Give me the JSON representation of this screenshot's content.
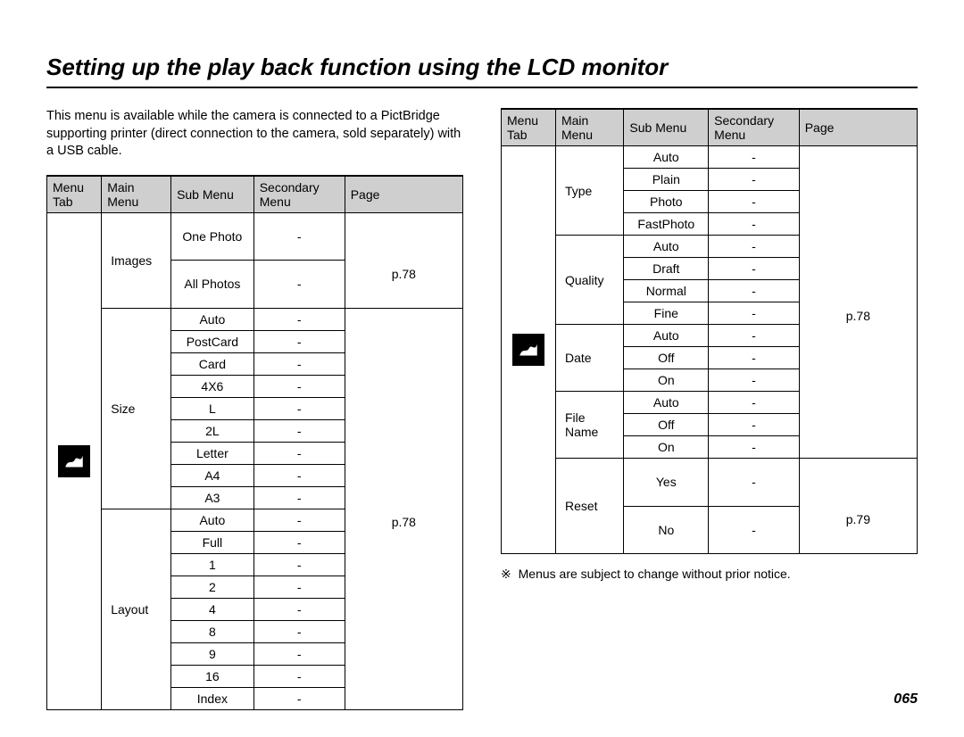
{
  "title": "Setting up the play back function using the LCD monitor",
  "intro": "This menu is available while the camera is connected to a PictBridge supporting printer (direct connection to the camera, sold separately) with a USB cable.",
  "headers": {
    "menu_tab": "Menu Tab",
    "main_menu": "Main Menu",
    "sub_menu": "Sub Menu",
    "secondary_menu": "Secondary Menu",
    "page": "Page"
  },
  "left_table": {
    "page_ref_images": "p.78",
    "page_ref_rest": "p.78",
    "groups": [
      {
        "main": "Images",
        "subs": [
          "One Photo",
          "All Photos"
        ]
      },
      {
        "main": "Size",
        "subs": [
          "Auto",
          "PostCard",
          "Card",
          "4X6",
          "L",
          "2L",
          "Letter",
          "A4",
          "A3"
        ]
      },
      {
        "main": "Layout",
        "subs": [
          "Auto",
          "Full",
          "1",
          "2",
          "4",
          "8",
          "9",
          "16",
          "Index"
        ]
      }
    ]
  },
  "right_table": {
    "page_ref_1": "p.78",
    "page_ref_2": "p.79",
    "groups": [
      {
        "main": "Type",
        "subs": [
          "Auto",
          "Plain",
          "Photo",
          "FastPhoto"
        ]
      },
      {
        "main": "Quality",
        "subs": [
          "Auto",
          "Draft",
          "Normal",
          "Fine"
        ]
      },
      {
        "main": "Date",
        "subs": [
          "Auto",
          "Off",
          "On"
        ]
      },
      {
        "main": "File Name",
        "subs": [
          "Auto",
          "Off",
          "On"
        ]
      },
      {
        "main": "Reset",
        "subs": [
          "Yes",
          "No"
        ]
      }
    ]
  },
  "note_symbol": "※",
  "note_text": "Menus are subject to change without prior notice.",
  "page_number": "065",
  "dash": "-"
}
